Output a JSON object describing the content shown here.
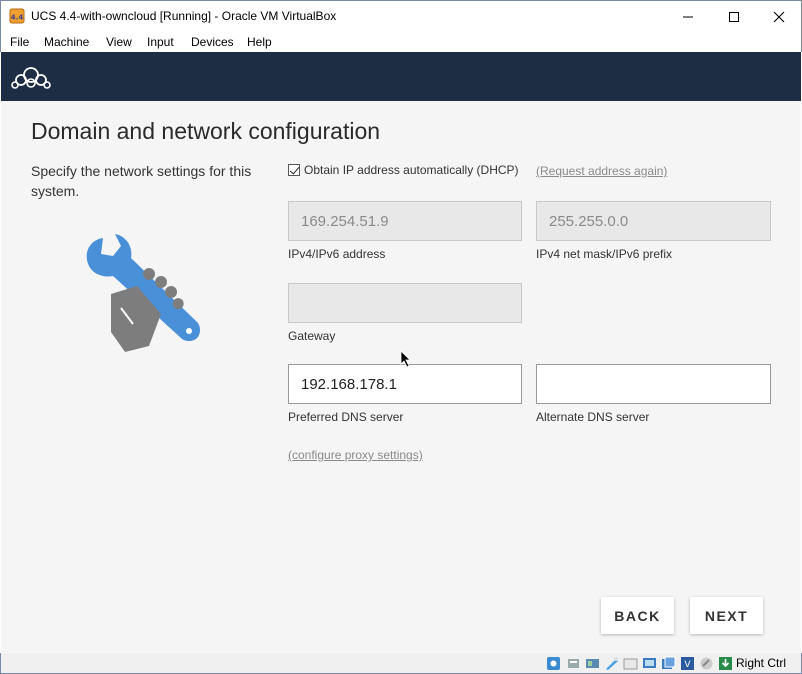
{
  "window": {
    "title": "UCS 4.4-with-owncloud [Running] - Oracle VM VirtualBox",
    "app_icon": "virtualbox-icon",
    "controls": [
      "minimize-icon",
      "maximize-icon",
      "close-icon"
    ]
  },
  "menu": {
    "items": [
      "File",
      "Machine",
      "View",
      "Input",
      "Devices",
      "Help"
    ]
  },
  "header": {
    "logo": "owncloud-cloud-icon"
  },
  "page": {
    "title": "Domain and network configuration",
    "description": "Specify the network settings for this system.",
    "illustration": "wrench-hand-icon"
  },
  "network": {
    "dhcp_label": "Obtain IP address automatically (DHCP)",
    "dhcp_checked": true,
    "request_again_link": "(Request address again)",
    "ip_value": "169.254.51.9",
    "ip_label": "IPv4/IPv6 address",
    "mask_value": "255.255.0.0",
    "mask_label": "IPv4 net mask/IPv6 prefix",
    "gateway_value": "",
    "gateway_label": "Gateway",
    "preferred_dns_value": "192.168.178.1",
    "preferred_dns_label": "Preferred DNS server",
    "alternate_dns_value": "",
    "alternate_dns_label": "Alternate DNS server",
    "proxy_link": "(configure proxy settings)"
  },
  "buttons": {
    "back": "BACK",
    "next": "NEXT"
  },
  "statusbar": {
    "host_key": "Right Ctrl",
    "icons": [
      "hard-disk-icon",
      "optical-drive-icon",
      "audio-icon",
      "network-icon",
      "usb-icon",
      "shared-folders-icon",
      "display-icon",
      "recording-icon",
      "vt-x-icon",
      "mouse-integration-icon",
      "keyboard-capture-icon"
    ]
  },
  "colors": {
    "header_bg": "#1d2d44",
    "wrench_blue": "#4a90d9",
    "hand_gray": "#7d7d7d"
  }
}
